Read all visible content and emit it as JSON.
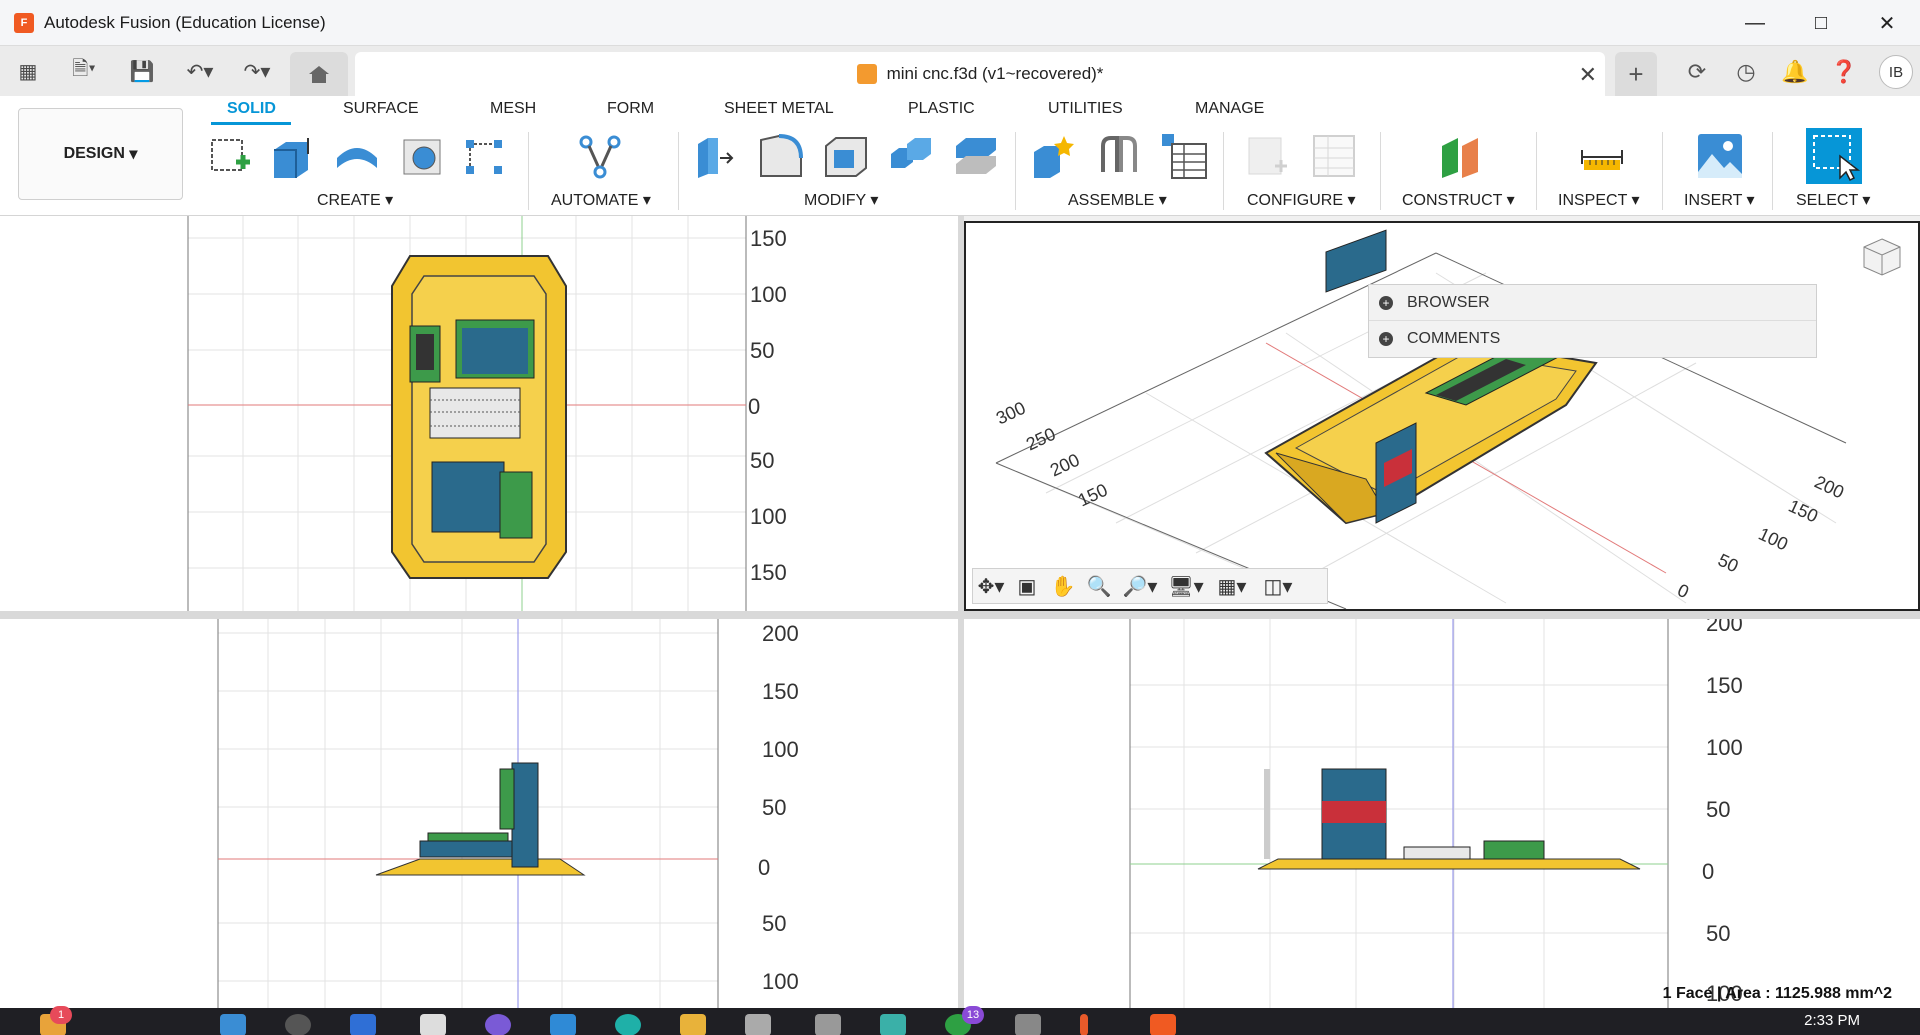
{
  "window": {
    "title": "Autodesk Fusion (Education License)",
    "logo": "F"
  },
  "document": {
    "tab_title": "mini cnc.f3d (v1~recovered)*"
  },
  "user": {
    "initials": "IB"
  },
  "ribbon": {
    "workspace": "DESIGN",
    "tabs": [
      "SOLID",
      "SURFACE",
      "MESH",
      "FORM",
      "SHEET METAL",
      "PLASTIC",
      "UTILITIES",
      "MANAGE"
    ],
    "active_tab": "SOLID",
    "groups": [
      "CREATE",
      "AUTOMATE",
      "MODIFY",
      "ASSEMBLE",
      "CONFIGURE",
      "CONSTRUCT",
      "INSPECT",
      "INSERT",
      "SELECT"
    ]
  },
  "viewports": {
    "top": {
      "axis_labels": [
        "150",
        "100",
        "50",
        "0",
        "50",
        "100",
        "150"
      ]
    },
    "iso": {
      "axis_labels_left": [
        "300",
        "250",
        "200",
        "150"
      ],
      "axis_labels_right": [
        "200",
        "150",
        "100",
        "50",
        "0"
      ]
    },
    "front": {
      "axis_labels": [
        "200",
        "150",
        "100",
        "50",
        "0",
        "50",
        "100"
      ]
    },
    "right": {
      "axis_labels": [
        "200",
        "150",
        "100",
        "50",
        "0",
        "50",
        "100"
      ]
    }
  },
  "browser_panel": {
    "items": [
      "BROWSER",
      "COMMENTS"
    ]
  },
  "status_bar": {
    "selection": "1 Face | Area : 1125.988 mm^2"
  },
  "taskbar": {
    "clock": "2:33 PM",
    "badges": [
      "1",
      "13"
    ]
  },
  "colors": {
    "accent": "#0696d7",
    "base_plate": "#f2c530",
    "board_blue": "#2a6a8c",
    "pcb_green": "#3d9a4a"
  }
}
